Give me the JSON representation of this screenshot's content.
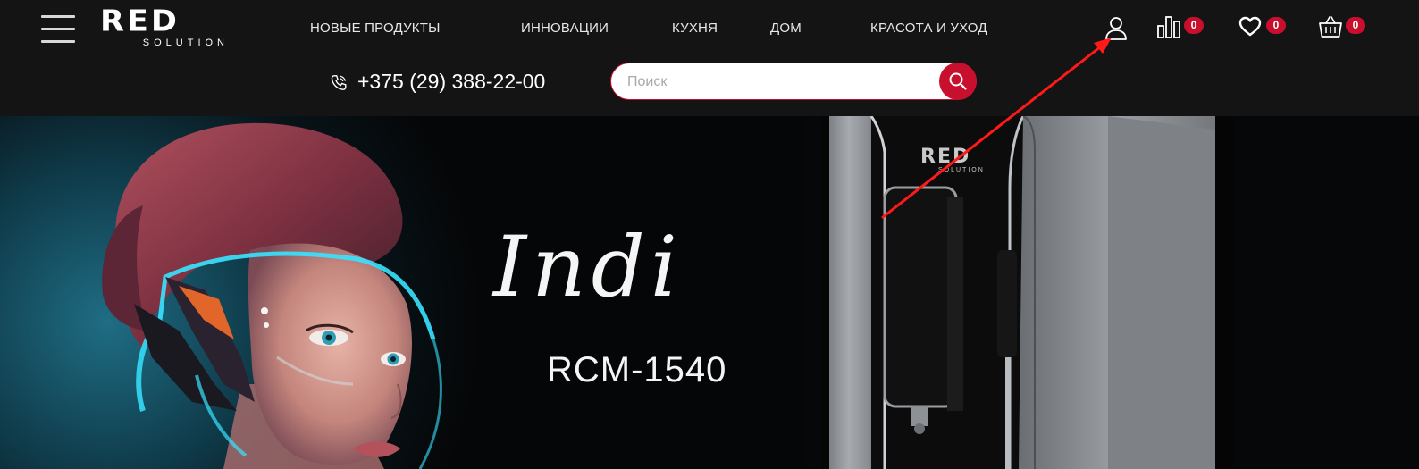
{
  "header": {
    "logo": {
      "main": "RED",
      "sub": "SOLUTION"
    },
    "nav": [
      {
        "label": "НОВЫЕ ПРОДУКТЫ"
      },
      {
        "label": "ИННОВАЦИИ"
      },
      {
        "label": "КУХНЯ"
      },
      {
        "label": "ДОМ"
      },
      {
        "label": "КРАСОТА И УХОД"
      }
    ],
    "phone": "+375 (29) 388-22-00",
    "search": {
      "placeholder": "Поиск",
      "value": ""
    },
    "icons": {
      "account": {
        "icon": "user-icon"
      },
      "compare": {
        "icon": "bar-chart-icon",
        "count": "0"
      },
      "favorites": {
        "icon": "heart-icon",
        "count": "0"
      },
      "cart": {
        "icon": "basket-icon",
        "count": "0"
      }
    },
    "accent_color": "#c8102e",
    "background_color": "#141414"
  },
  "hero": {
    "title": "Indi",
    "model": "RCM-1540",
    "product_logo": {
      "main": "RED",
      "sub": "SOLUTION"
    }
  },
  "annotation": {
    "type": "red-arrow",
    "target": "user-icon"
  }
}
